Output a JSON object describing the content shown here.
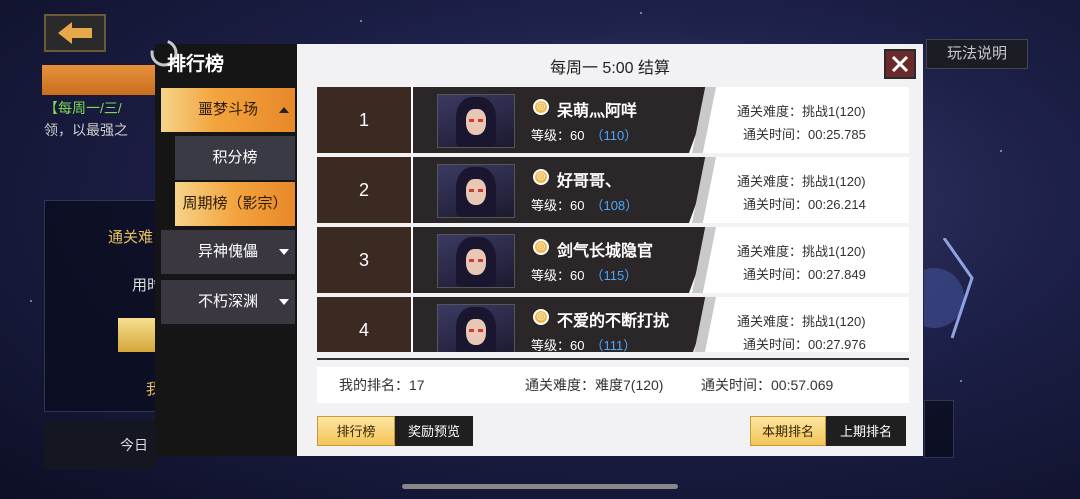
{
  "background": {
    "help_tab": "玩法说明",
    "left_text_line1_hl": "【每周一/三/",
    "left_text_line2": "领，以最强之",
    "left_box1": "通关难",
    "left_box2": "用时",
    "left_box3": "我",
    "left_bottom": "今日"
  },
  "sidebar": {
    "title": "排行榜",
    "items": [
      {
        "label": "噩梦斗场",
        "state": "expanded"
      },
      {
        "label": "积分榜",
        "state": "sub"
      },
      {
        "label": "周期榜（影宗）",
        "state": "selected"
      },
      {
        "label": "异神傀儡",
        "state": "collapsed"
      },
      {
        "label": "不朽深渊",
        "state": "collapsed"
      }
    ]
  },
  "main": {
    "title": "每周一 5:00 结算",
    "rows": [
      {
        "rank": "1",
        "name": "呆萌灬阿咩",
        "level_label": "等级：60",
        "power": "（110）",
        "difficulty": "通关难度：挑战1(120)",
        "time": "通关时间：00:25.785"
      },
      {
        "rank": "2",
        "name": "好哥哥、",
        "level_label": "等级：60",
        "power": "（108）",
        "difficulty": "通关难度：挑战1(120)",
        "time": "通关时间：00:26.214"
      },
      {
        "rank": "3",
        "name": "剑气长城隐官",
        "level_label": "等级：60",
        "power": "（115）",
        "difficulty": "通关难度：挑战1(120)",
        "time": "通关时间：00:27.849"
      },
      {
        "rank": "4",
        "name": "不爱的不断打扰",
        "level_label": "等级：60",
        "power": "（111）",
        "difficulty": "通关难度：挑战1(120)",
        "time": "通关时间：00:27.976"
      }
    ],
    "my": {
      "rank": "我的排名：17",
      "difficulty": "通关难度：难度7(120)",
      "time": "通关时间：00:57.069"
    },
    "buttons": {
      "leaderboard": "排行榜",
      "rewards": "奖励预览",
      "this_period": "本期排名",
      "last_period": "上期排名"
    }
  },
  "colors": {
    "accent_orange": "#f3a43e",
    "power_blue": "#4aa8ff",
    "row_dark": "#2b2628"
  }
}
